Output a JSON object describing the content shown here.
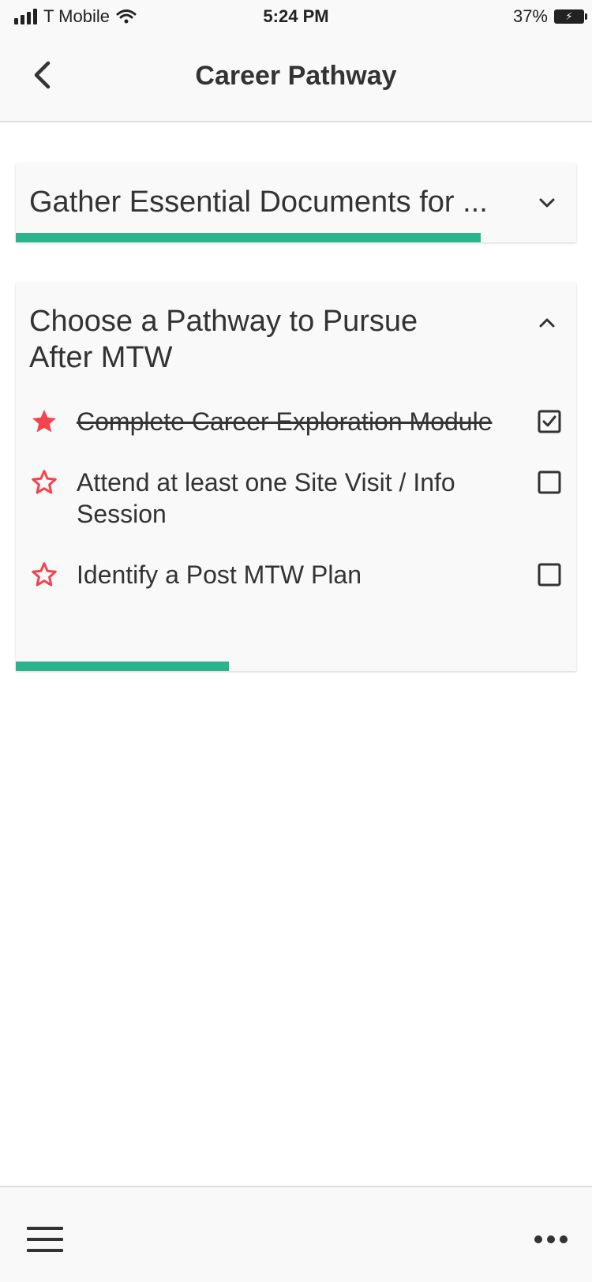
{
  "status_bar": {
    "carrier": "T Mobile",
    "time": "5:24 PM",
    "battery": "37%",
    "icons": [
      "signal-icon",
      "wifi-icon",
      "battery-icon"
    ]
  },
  "nav": {
    "title": "Career Pathway",
    "back_icon": "chevron-left-icon"
  },
  "sections": [
    {
      "title": "Gather Essential Documents for ...",
      "expanded": false,
      "progress": 0.83,
      "chevron_icon": "chevron-down-icon"
    },
    {
      "title": "Choose a Pathway to Pursue After MTW",
      "expanded": true,
      "progress": 0.38,
      "chevron_icon": "chevron-up-icon",
      "tasks": [
        {
          "label": "Complete Career Exploration Module",
          "starred": true,
          "checked": true
        },
        {
          "label": "Attend at least one Site Visit / Info Session",
          "starred": false,
          "checked": false
        },
        {
          "label": "Identify a Post MTW Plan",
          "starred": false,
          "checked": false
        }
      ]
    }
  ],
  "bottom_bar": {
    "menu_icon": "hamburger-menu-icon",
    "more_icon": "more-horizontal-icon"
  },
  "colors": {
    "accent": "#2bb38c",
    "star": "#f5434e",
    "text": "#333333",
    "bar_bg": "#f9f9f9"
  }
}
